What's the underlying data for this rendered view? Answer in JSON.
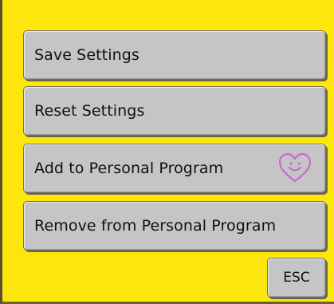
{
  "colors": {
    "background": "#fde60d",
    "button_face": "#c5c5c5",
    "button_border": "#6f6f6f",
    "heart_icon": "#cc66cc"
  },
  "menu": {
    "buttons": [
      {
        "label": "Save Settings"
      },
      {
        "label": "Reset Settings"
      },
      {
        "label": "Add to Personal Program",
        "icon": "smiley-heart-icon"
      },
      {
        "label": "Remove from Personal Program"
      }
    ]
  },
  "esc_button": {
    "label": "ESC"
  }
}
